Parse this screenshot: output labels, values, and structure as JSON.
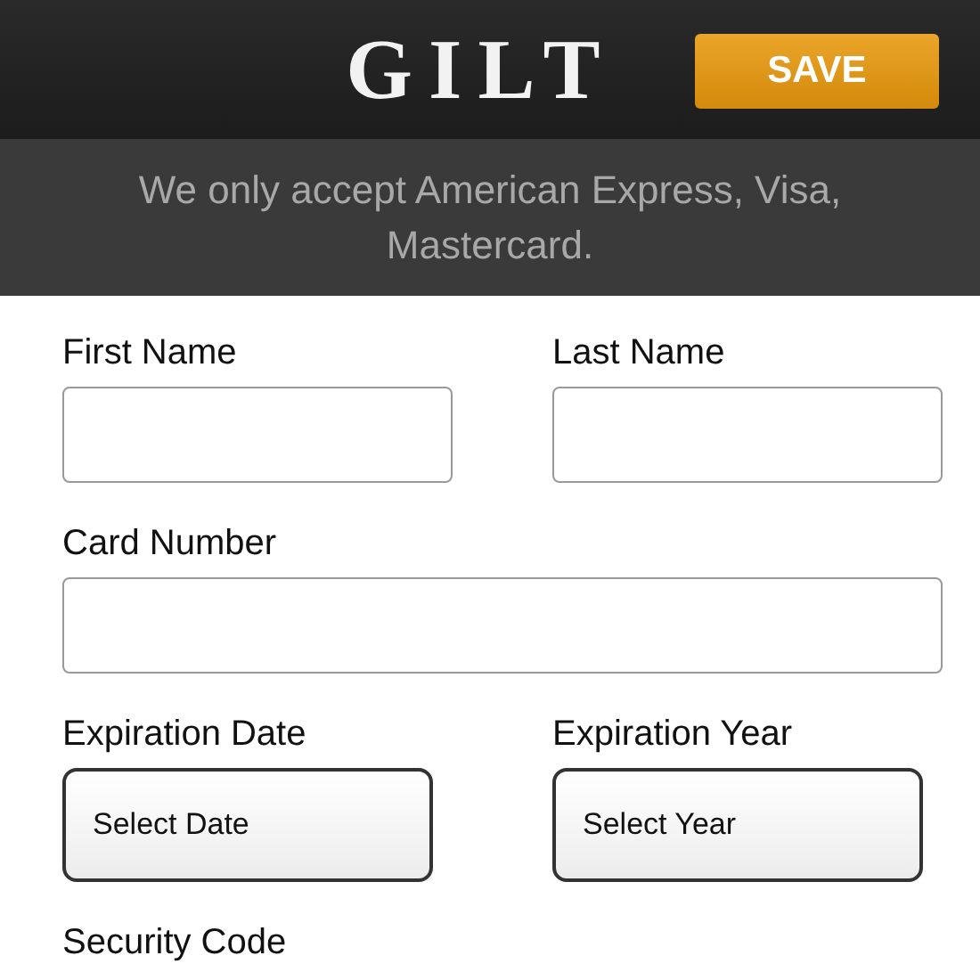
{
  "header": {
    "logo": "GILT",
    "save_button": "SAVE"
  },
  "notice": "We only accept American Express, Visa, Mastercard.",
  "rows": [
    [
      {
        "kind": "input",
        "label": "First Name"
      },
      {
        "kind": "input",
        "label": "Last Name"
      }
    ],
    [
      {
        "kind": "input",
        "label": "Card Number"
      }
    ],
    [
      {
        "kind": "select",
        "label": "Expiration Date",
        "value": "Select Date"
      },
      {
        "kind": "select",
        "label": "Expiration Year",
        "value": "Select Year"
      }
    ],
    [
      {
        "kind": "label",
        "label": "Security Code"
      }
    ]
  ]
}
